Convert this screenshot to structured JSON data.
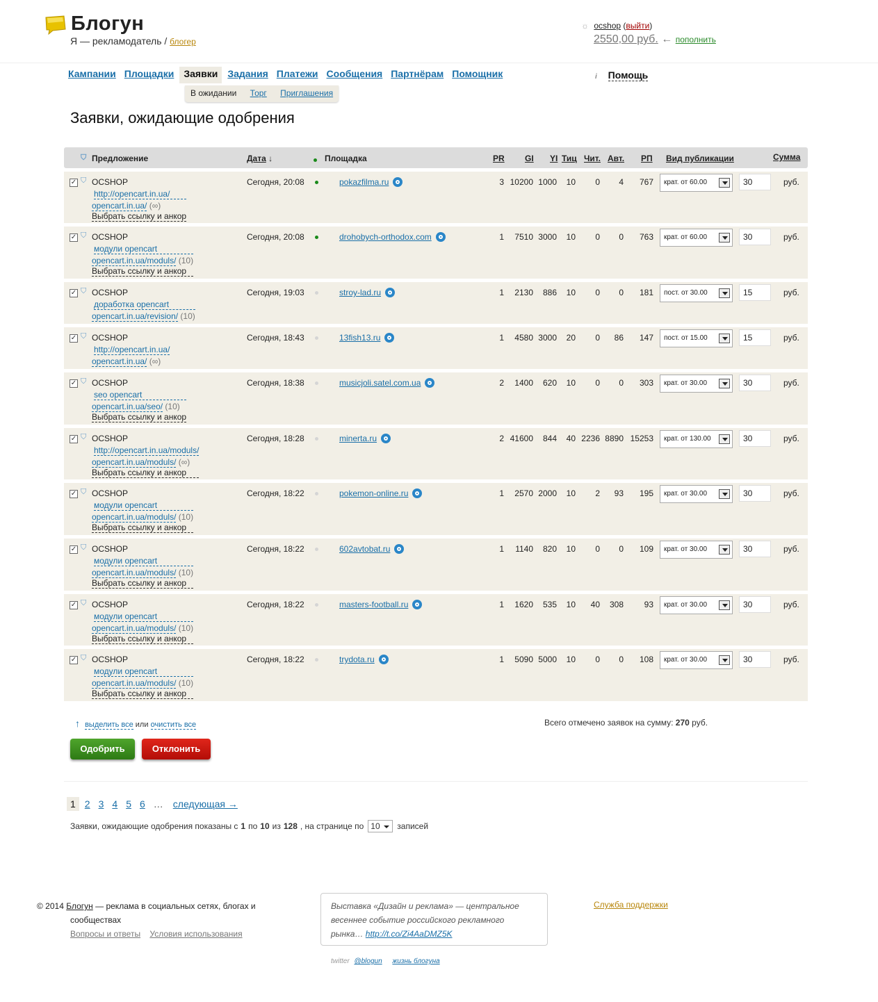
{
  "header": {
    "logo_text": "Блогун",
    "subtitle_role": "Я — рекламодатель",
    "subtitle_sep": "/",
    "subtitle_link": "блогер",
    "username": "ocshop",
    "logout": "выйти",
    "balance": "2550,00 руб.",
    "balance_arrow": "←",
    "topup": "пополнить",
    "brand_color": "#e8c200"
  },
  "nav": {
    "items": [
      "Кампании",
      "Площадки",
      "Заявки",
      "Задания",
      "Платежи",
      "Сообщения",
      "Партнёрам",
      "Помощник"
    ],
    "active": "Заявки",
    "sub": {
      "current": "В ожидании",
      "links": [
        "Торг",
        "Приглашения"
      ]
    },
    "help": "Помощь"
  },
  "page_title": "Заявки, ожидающие одобрения",
  "table": {
    "headers": {
      "offer": "Предложение",
      "date": "Дата",
      "site": "Площадка",
      "pr": "PR",
      "gi": "GI",
      "yi": "YI",
      "tic": "Тиц",
      "readers": "Чит.",
      "authors": "Авт.",
      "rp": "РП",
      "pub": "Вид публикации",
      "sum": "Сумма"
    },
    "rows": [
      {
        "offer": "OCSHOP",
        "l1": "http://opencart.in.ua/",
        "l2": "opencart.in.ua/",
        "l2c": "(∞)",
        "l3": "Выбрать ссылку и анкор",
        "date": "Сегодня, 20:08",
        "dot": "green",
        "site": "pokazfilma.ru",
        "pr": "3",
        "gi": "10200",
        "yi": "1000",
        "tic": "10",
        "readers": "0",
        "authors": "4",
        "rp": "767",
        "pub": "крат. от 60.00",
        "sum": "30",
        "cur": "руб."
      },
      {
        "offer": "OCSHOP",
        "l1": "модули opencart",
        "l2": "opencart.in.ua/moduls/",
        "l2c": "(10)",
        "l3": "Выбрать ссылку и анкор",
        "date": "Сегодня, 20:08",
        "dot": "green",
        "site": "drohobych-orthodox.com",
        "pr": "1",
        "gi": "7510",
        "yi": "3000",
        "tic": "10",
        "readers": "0",
        "authors": "0",
        "rp": "763",
        "pub": "крат. от 60.00",
        "sum": "30",
        "cur": "руб."
      },
      {
        "offer": "OCSHOP",
        "l1": "доработка opencart",
        "l2": "opencart.in.ua/revision/",
        "l2c": "(10)",
        "l3": "",
        "date": "Сегодня, 19:03",
        "dot": "gray",
        "site": "stroy-lad.ru",
        "pr": "1",
        "gi": "2130",
        "yi": "886",
        "tic": "10",
        "readers": "0",
        "authors": "0",
        "rp": "181",
        "pub": "пост. от 30.00",
        "sum": "15",
        "cur": "руб."
      },
      {
        "offer": "OCSHOP",
        "l1": "http://opencart.in.ua/",
        "l2": "opencart.in.ua/",
        "l2c": "(∞)",
        "l3": "",
        "date": "Сегодня, 18:43",
        "dot": "gray",
        "site": "13fish13.ru",
        "pr": "1",
        "gi": "4580",
        "yi": "3000",
        "tic": "20",
        "readers": "0",
        "authors": "86",
        "rp": "147",
        "pub": "пост. от 15.00",
        "sum": "15",
        "cur": "руб."
      },
      {
        "offer": "OCSHOP",
        "l1": "seo opencart",
        "l2": "opencart.in.ua/seo/",
        "l2c": "(10)",
        "l3": "Выбрать ссылку и анкор",
        "date": "Сегодня, 18:38",
        "dot": "gray",
        "site": "musicjoli.satel.com.ua",
        "pr": "2",
        "gi": "1400",
        "yi": "620",
        "tic": "10",
        "readers": "0",
        "authors": "0",
        "rp": "303",
        "pub": "крат. от 30.00",
        "sum": "30",
        "cur": "руб."
      },
      {
        "offer": "OCSHOP",
        "l1": "http://opencart.in.ua/moduls/",
        "l2": "opencart.in.ua/moduls/",
        "l2c": "(∞)",
        "l3": "Выбрать ссылку и анкор",
        "date": "Сегодня, 18:28",
        "dot": "gray",
        "site": "minerta.ru",
        "pr": "2",
        "gi": "41600",
        "yi": "844",
        "tic": "40",
        "readers": "2236",
        "authors": "8890",
        "rp": "15253",
        "pub": "крат. от 130.00",
        "sum": "30",
        "cur": "руб."
      },
      {
        "offer": "OCSHOP",
        "l1": "модули opencart",
        "l2": "opencart.in.ua/moduls/",
        "l2c": "(10)",
        "l3": "Выбрать ссылку и анкор",
        "date": "Сегодня, 18:22",
        "dot": "gray",
        "site": "pokemon-online.ru",
        "pr": "1",
        "gi": "2570",
        "yi": "2000",
        "tic": "10",
        "readers": "2",
        "authors": "93",
        "rp": "195",
        "pub": "крат. от 30.00",
        "sum": "30",
        "cur": "руб."
      },
      {
        "offer": "OCSHOP",
        "l1": "модули opencart",
        "l2": "opencart.in.ua/moduls/",
        "l2c": "(10)",
        "l3": "Выбрать ссылку и анкор",
        "date": "Сегодня, 18:22",
        "dot": "gray",
        "site": "602avtobat.ru",
        "pr": "1",
        "gi": "1140",
        "yi": "820",
        "tic": "10",
        "readers": "0",
        "authors": "0",
        "rp": "109",
        "pub": "крат. от 30.00",
        "sum": "30",
        "cur": "руб."
      },
      {
        "offer": "OCSHOP",
        "l1": "модули opencart",
        "l2": "opencart.in.ua/moduls/",
        "l2c": "(10)",
        "l3": "Выбрать ссылку и анкор",
        "date": "Сегодня, 18:22",
        "dot": "gray",
        "site": "masters-football.ru",
        "pr": "1",
        "gi": "1620",
        "yi": "535",
        "tic": "10",
        "readers": "40",
        "authors": "308",
        "rp": "93",
        "pub": "крат. от 30.00",
        "sum": "30",
        "cur": "руб."
      },
      {
        "offer": "OCSHOP",
        "l1": "модули opencart",
        "l2": "opencart.in.ua/moduls/",
        "l2c": "(10)",
        "l3": "Выбрать ссылку и анкор",
        "date": "Сегодня, 18:22",
        "dot": "gray",
        "site": "trydota.ru",
        "pr": "1",
        "gi": "5090",
        "yi": "5000",
        "tic": "10",
        "readers": "0",
        "authors": "0",
        "rp": "108",
        "pub": "крат. от 30.00",
        "sum": "30",
        "cur": "руб."
      }
    ]
  },
  "select_all": {
    "arrow": "↑",
    "select": "выделить все",
    "or": "или",
    "clear": "очистить все"
  },
  "total": {
    "label": "Всего отмечено заявок на сумму:",
    "value": "270",
    "cur": "руб."
  },
  "buttons": {
    "approve": "Одобрить",
    "reject": "Отклонить"
  },
  "pager": {
    "current": "1",
    "pages": [
      "2",
      "3",
      "4",
      "5",
      "6"
    ],
    "ellipsis": "…",
    "next": "следующая →",
    "info_pre": "Заявки, ожидающие одобрения показаны с",
    "from": "1",
    "to_word": "по",
    "to": "10",
    "of_word": "из",
    "total": "128",
    "per_page_label": ", на странице по",
    "per_page": "10",
    "records": "записей"
  },
  "footer": {
    "copy": "© 2014",
    "brand": "Блогун",
    "tagline": "— реклама в социальных сетях, блогах и",
    "tagline2": "сообществах",
    "faq": "Вопросы и ответы",
    "terms": "Условия использования",
    "tweet": "Выставка «Дизайн и реклама» — центральное весеннее событие российского рекламного рынка…",
    "tweet_link": "http://t.co/Zi4AaDMZ5K",
    "twitter_label": "twitter",
    "twitter_handle": "@blogun",
    "life": "жизнь блогуна",
    "support": "Служба поддержки"
  }
}
